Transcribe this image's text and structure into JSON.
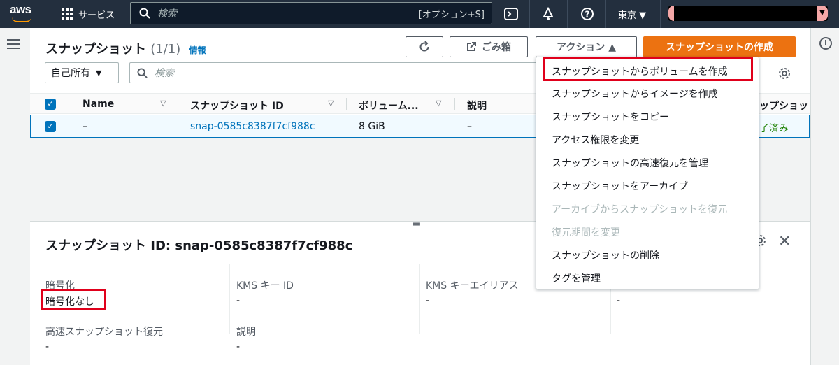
{
  "nav": {
    "logo": "aws",
    "services": "サービス",
    "search_placeholder": "検索",
    "search_shortcut": "[オプション+S]",
    "region": "東京 ▼"
  },
  "page": {
    "title": "スナップショット",
    "count": "(1/1)",
    "info": "情報",
    "refresh_icon": "refresh-icon",
    "recycle_bin": "ごみ箱",
    "actions": "アクション ▲",
    "create": "スナップショットの作成",
    "owner_filter": "自己所有",
    "filter_placeholder": "検索"
  },
  "table": {
    "headers": [
      "Name",
      "スナップショット ID",
      "ボリューム...",
      "説明",
      "ップショッ"
    ],
    "rows": [
      {
        "name": "–",
        "id": "snap-0585c8387f7cf988c",
        "volume": "8 GiB",
        "description": "–",
        "status": "了済み"
      }
    ]
  },
  "menu": {
    "items": [
      {
        "label": "スナップショットからボリュームを作成",
        "disabled": false
      },
      {
        "label": "スナップショットからイメージを作成",
        "disabled": false
      },
      {
        "label": "スナップショットをコピー",
        "disabled": false
      },
      {
        "label": "アクセス権限を変更",
        "disabled": false
      },
      {
        "label": "スナップショットの高速復元を管理",
        "disabled": false
      },
      {
        "label": "スナップショットをアーカイブ",
        "disabled": false
      },
      {
        "label": "アーカイブからスナップショットを復元",
        "disabled": true
      },
      {
        "label": "復元期間を変更",
        "disabled": true
      },
      {
        "label": "スナップショットの削除",
        "disabled": false
      },
      {
        "label": "タグを管理",
        "disabled": false
      }
    ]
  },
  "detail": {
    "title": "スナップショット ID: snap-0585c8387f7cf988c",
    "fields": [
      {
        "label": "暗号化",
        "value": "暗号化なし"
      },
      {
        "label": "KMS キー ID",
        "value": "-"
      },
      {
        "label": "KMS キーエイリアス",
        "value": "-"
      },
      {
        "label": "",
        "value": "-"
      },
      {
        "label": "高速スナップショット復元",
        "value": "-"
      },
      {
        "label": "説明",
        "value": "-"
      }
    ]
  },
  "colors": {
    "nav_bg": "#232f3e",
    "accent_orange": "#ec7211",
    "link_blue": "#0073bb",
    "highlight_red": "#e0001b"
  }
}
